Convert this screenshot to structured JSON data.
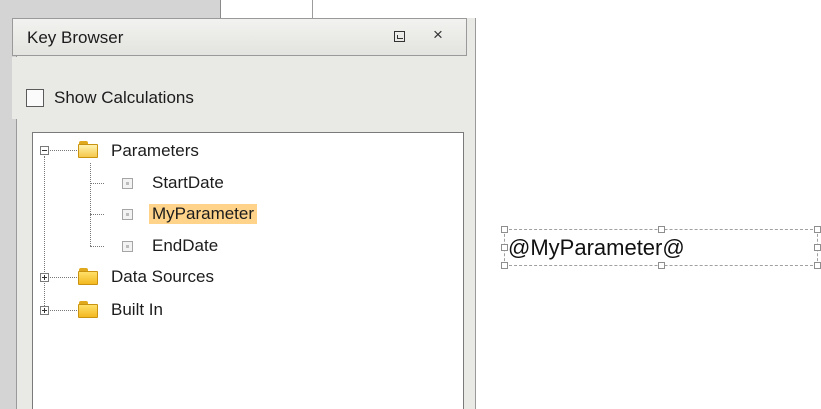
{
  "panel": {
    "title": "Key Browser",
    "minimize_icon": "restore-icon",
    "close_label": "×"
  },
  "options": {
    "show_calculations_label": "Show Calculations",
    "show_calculations_checked": false
  },
  "tree": {
    "nodes": [
      {
        "label": "Parameters",
        "type": "folder",
        "expanded": true
      },
      {
        "label": "StartDate",
        "type": "key"
      },
      {
        "label": "MyParameter",
        "type": "key",
        "selected": true
      },
      {
        "label": "EndDate",
        "type": "key"
      },
      {
        "label": "Data Sources",
        "type": "folder",
        "expanded": false
      },
      {
        "label": "Built In",
        "type": "folder",
        "expanded": false
      }
    ]
  },
  "canvas": {
    "element_text": "@MyParameter@"
  },
  "colors": {
    "selection": "#ffd38a",
    "folder": "#f3b820",
    "panel_bg": "#e9e9e6"
  }
}
